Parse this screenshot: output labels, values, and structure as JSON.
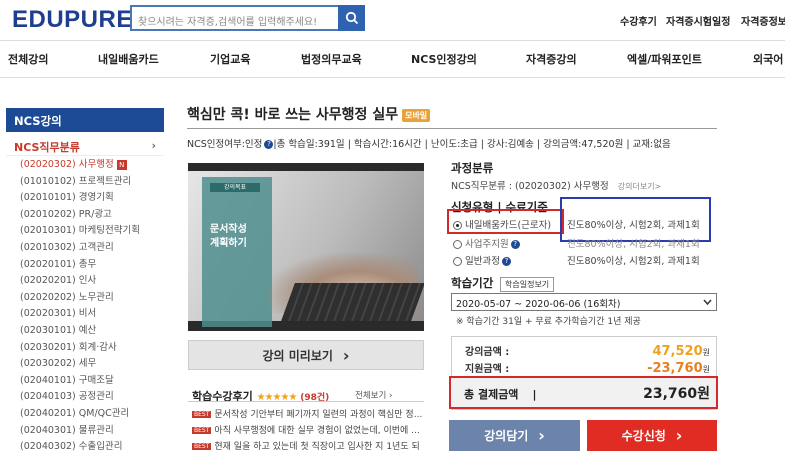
{
  "header": {
    "logo": "EDUPURE",
    "search_placeholder": "찾으시려는 자격증,검색어를 입력해주세요!",
    "top_links": [
      "수강후기",
      "자격증시험일정",
      "자격증정보"
    ]
  },
  "gnb": [
    "전체강의",
    "내일배움카드",
    "기업교육",
    "법정의무교육",
    "NCS인정강의",
    "자격증강의",
    "엑셀/파워포인트",
    "외국어"
  ],
  "sidebar": {
    "heading": "NCS강의",
    "sub": "NCS직무분류",
    "sub_arrow": "›",
    "new_badge": "N",
    "items": [
      "(02020302) 사무행정",
      "(01010102) 프로젝트관리",
      "(02010101) 경영기획",
      "(02010202) PR/광고",
      "(02010301) 마케팅전략기획",
      "(02010302) 고객관리",
      "(02020101) 총무",
      "(02020201) 인사",
      "(02020202) 노무관리",
      "(02020301) 비서",
      "(02030101) 예산",
      "(02030201) 회계·감사",
      "(02030202) 세무",
      "(02040101) 구매조달",
      "(02040103) 공정관리",
      "(02040201) QM/QC관리",
      "(02040301) 물류관리",
      "(02040302) 수출입관리"
    ]
  },
  "course": {
    "title": "핵심만 콕! 바로 쓰는 사무행정 실무",
    "title_badge": "모바일",
    "meta_pre": "NCS인정여부:인정",
    "meta_post": "|총 학습일:391일 | 학습시간:16시간 | 난이도:초급 | 강사:김예송 | 강의금액:47,520원 | 교재:없음",
    "video_slide_tag": "강의목표",
    "video_slide_text": "문서작성 계획하기",
    "preview_label": "강의 미리보기",
    "arrow": "›"
  },
  "reviews": {
    "title": "학습수강후기",
    "stars": "★★★★★",
    "count": "(98건)",
    "more": "전체보기 ›",
    "best_label": "BEST",
    "items": [
      "문서작성 기안부터 폐기까지 일련의 과정이 핵심만 정...",
      "아직 사무행정에 대한 실무 경험이 없었는데, 이번에 ...",
      "현재 일을 하고 있는데 첫 직장이고 입사한 지 1년도 되"
    ]
  },
  "category": {
    "title": "과정분류",
    "value": "NCS직무분류 : (02020302) 사무행정",
    "more": "강의더보기>"
  },
  "apply_type": {
    "title": "신청유형 | 수료기준",
    "options": [
      {
        "label": "내일배움카드(근로자)",
        "criteria": "진도80%이상, 시험2회, 과제1회",
        "selected": true
      },
      {
        "label": "사업주지원",
        "criteria": "진도80%이상, 시험2회, 과제1회",
        "selected": false
      },
      {
        "label": "일반과정",
        "criteria": "진도80%이상, 시험2회, 과제1회",
        "selected": false
      }
    ]
  },
  "period": {
    "title": "학습기간",
    "schedule_button": "학습일정보기",
    "selected": "2020-05-07 ~ 2020-06-06 (16회차)",
    "note": "※ 학습기간 31일 + 무료 추가학습기간 1년 제공"
  },
  "price": {
    "course_label": "강의금액 :",
    "course_value": "47,520",
    "support_label": "지원금액 :",
    "support_value": "-23,760",
    "total_label": "총 결제금액",
    "total_value": "23,760원",
    "unit": "원"
  },
  "actions": {
    "cart": "강의담기",
    "apply": "수강신청",
    "arrow": "›"
  },
  "colors": {
    "brand": "#1e3e8f",
    "accent_red": "#e12c24",
    "price_orange": "#f0a21e",
    "highlight_red_box": "#d22a2a",
    "highlight_blue_box": "#2b3cb0"
  }
}
